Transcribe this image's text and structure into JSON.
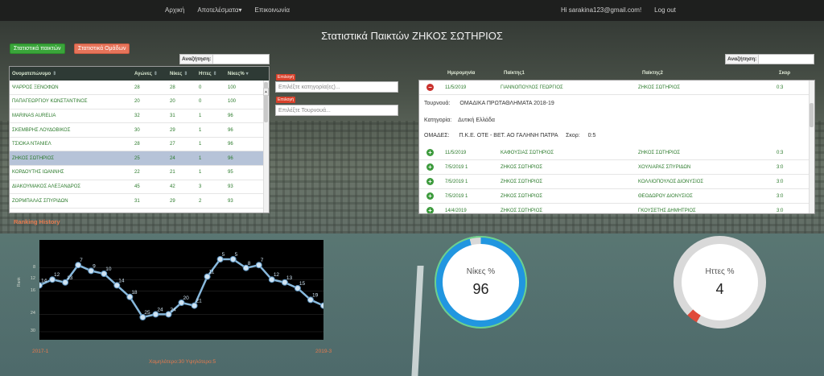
{
  "nav": {
    "home": "Αρχική",
    "results": "Αποτελέσματα",
    "contact": "Επικοινωνία",
    "user": "Hi sarakina123@gmail.com!",
    "logout": "Log out"
  },
  "page_title": "Στατιστικά Παικτών ΖΗΚΟΣ ΣΩΤΗΡΙΟΣ",
  "tabs": {
    "players": "Στατιστικά παικτών",
    "teams": "Στατιστικά Ομάδων"
  },
  "search_label": "Αναζήτηση:",
  "players_table": {
    "headers": [
      "Ονοματεπώνυμο",
      "Αγώνες",
      "Νίκες",
      "Ηττες",
      "Νίκες%"
    ],
    "rows": [
      [
        "ΨΑΡΡΟΣ ΞΕΝΟΦΩΝ",
        "28",
        "28",
        "0",
        "100"
      ],
      [
        "ΠΑΠΑΓΕΩΡΓΙΟΥ ΚΩΝΣΤΑΝΤΙΝΟΣ",
        "20",
        "20",
        "0",
        "100"
      ],
      [
        "MARINAS AURELIA",
        "32",
        "31",
        "1",
        "96"
      ],
      [
        "ΣΚΕΜΒΡΗΣ ΛΟΥΔΟΒΙΚΟΣ",
        "30",
        "29",
        "1",
        "96"
      ],
      [
        "ΤΣΙΟΚΑ ΝΤΑΝΙΕΛ",
        "28",
        "27",
        "1",
        "96"
      ],
      [
        "ΖΗΚΟΣ ΣΩΤΗΡΙΟΣ",
        "25",
        "24",
        "1",
        "96"
      ],
      [
        "ΚΟΡΔΟΥΤΗΣ ΙΩΑΝΝΗΣ",
        "22",
        "21",
        "1",
        "95"
      ],
      [
        "ΔΙΑΚΟΥΜΑΚΟΣ ΑΛΕΞΑΝΔΡΟΣ",
        "45",
        "42",
        "3",
        "93"
      ],
      [
        "ΖΟΡΜΠΑΛΑΣ ΣΠΥΡΙΔΩΝ",
        "31",
        "29",
        "2",
        "93"
      ]
    ],
    "selected_index": 5
  },
  "filters": {
    "select_label": "Επιλογή",
    "category_placeholder": "Επιλέξτε κατηγορία(ες)...",
    "tournament_placeholder": "Επιλέξτε Τουρνουά..."
  },
  "matches_table": {
    "headers": [
      "Ημερομηνία",
      "Παίκτης1",
      "Παίκτης2",
      "Σκορ"
    ],
    "expanded": {
      "date": "11/5/2019",
      "p1": "ΓΙΑΝΝΟΠΟΥΛΟΣ ΓΕΩΡΓΙΟΣ",
      "p2": "ΖΗΚΟΣ ΣΩΤΗΡΙΟΣ",
      "score": "0:3",
      "tournament_label": "Τουρνουά:",
      "tournament": "ΟΜΑΔΙΚΑ ΠΡΩΤΑΘΛΗΜΑΤΑ 2018-19",
      "category_label": "Κατηγορία:",
      "category": "Δυτική Ελλάδα",
      "teams_label": "ΟΜΑΔΕΣ:",
      "teams": "Π.Κ.Ε. ΟΤΕ - ΒΕΤ. ΑΟ ΓΑΛΗΝΗ ΠΑΤΡΑ",
      "score_label": "Σκορ:",
      "team_score": "0:5"
    },
    "rows": [
      [
        "11/5/2019",
        "ΚΑΦΟΥΣΙΑΣ ΣΩΤΗΡΙΟΣ",
        "ΖΗΚΟΣ ΣΩΤΗΡΙΟΣ",
        "0:3"
      ],
      [
        "7/5/2019 1",
        "ΖΗΚΟΣ ΣΩΤΗΡΙΟΣ",
        "ΧΟΥΛΙΑΡΑΣ ΣΠΥΡΙΔΩΝ",
        "3:0"
      ],
      [
        "7/5/2019 1",
        "ΖΗΚΟΣ ΣΩΤΗΡΙΟΣ",
        "ΚΟΛΛΙΟΠΟΥΛΟΣ ΔΙΟΝΥΣΙΟΣ",
        "3:0"
      ],
      [
        "7/5/2019 1",
        "ΖΗΚΟΣ ΣΩΤΗΡΙΟΣ",
        "ΘΕΟΔΩΡΟΥ ΔΙΟΝΥΣΙΟΣ",
        "3:0"
      ],
      [
        "14/4/2019",
        "ΖΗΚΟΣ ΣΩΤΗΡΙΟΣ",
        "ΓΚΟΥΣΕΤΗΣ ΔΗΜΗΤΡΙΟΣ",
        "3:0"
      ]
    ]
  },
  "ranking": {
    "title": "Ranking History",
    "x_start": "2017-1",
    "x_end": "2019-3",
    "footer": "Χαμηλότερο:30 Υψηλότερο:5",
    "ylabel": "Rank"
  },
  "chart_data": {
    "type": "line",
    "ylim": [
      0,
      30
    ],
    "yticks": [
      "8",
      "12",
      "16",
      "24",
      "30"
    ],
    "values": [
      14,
      12,
      13,
      7,
      9,
      10,
      14,
      18,
      25,
      24,
      24,
      20,
      21,
      11,
      5,
      5,
      8,
      7,
      12,
      13,
      15,
      19,
      21
    ],
    "line_color": "#87b8dc"
  },
  "gauges": {
    "wins": {
      "label": "Νίκες %",
      "value": "96",
      "pct": 96
    },
    "losses": {
      "label": "Ηττες %",
      "value": "4",
      "pct": 4
    }
  }
}
